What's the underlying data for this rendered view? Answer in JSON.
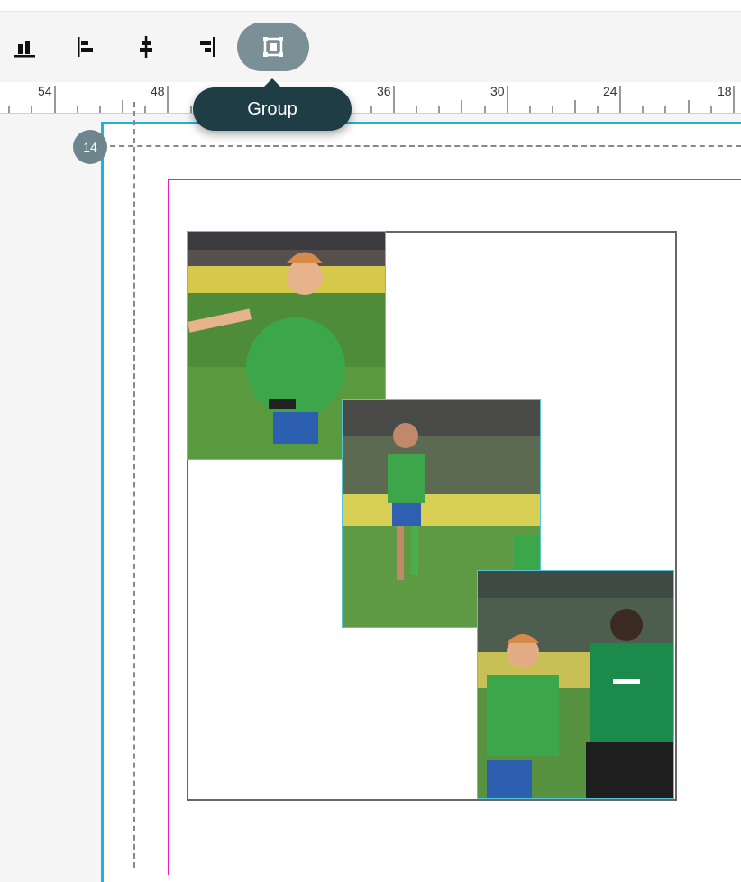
{
  "toolbar": {
    "tools": [
      {
        "name": "align-bottom",
        "icon": "align-bottom-icon"
      },
      {
        "name": "align-left",
        "icon": "align-left-icon"
      },
      {
        "name": "align-center-vertical",
        "icon": "align-center-icon"
      },
      {
        "name": "align-right",
        "icon": "align-right-icon"
      },
      {
        "name": "group",
        "icon": "group-icon",
        "active": true
      }
    ],
    "tooltip": "Group"
  },
  "ruler": {
    "labels": [
      "54",
      "48",
      "36",
      "30",
      "24",
      "18"
    ]
  },
  "page": {
    "badge": "14"
  },
  "colors": {
    "accent": "#1bb3e0",
    "margin": "#e61ec8",
    "tool_active": "#7a8f96",
    "tooltip_bg": "#1f3d45"
  }
}
